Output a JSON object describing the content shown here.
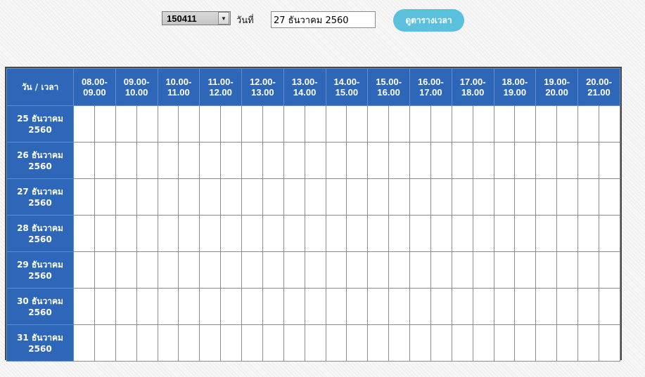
{
  "toolbar": {
    "room_value": "150411",
    "date_label": "วันที่",
    "date_value": "27 ธันวาคม 2560",
    "view_button": "ดูตารางเวลา",
    "dropdown_icon": "chevron-down-icon"
  },
  "colors": {
    "header_blue": "#2e67b8",
    "button_cyan": "#5bc0de",
    "grid_line": "#8c8c8c"
  },
  "schedule": {
    "corner_label": "วัน / เวลา",
    "time_slots": [
      "08.00-09.00",
      "09.00-10.00",
      "10.00-11.00",
      "11.00-12.00",
      "12.00-13.00",
      "13.00-14.00",
      "14.00-15.00",
      "15.00-16.00",
      "16.00-17.00",
      "17.00-18.00",
      "18.00-19.00",
      "19.00-20.00",
      "20.00-21.00"
    ],
    "days": [
      "25 ธันวาคม 2560",
      "26 ธันวาคม 2560",
      "27 ธันวาคม 2560",
      "28 ธันวาคม 2560",
      "29 ธันวาคม 2560",
      "30 ธันวาคม 2560",
      "31 ธันวาคม 2560"
    ],
    "half_slots_per_hour": 2
  }
}
